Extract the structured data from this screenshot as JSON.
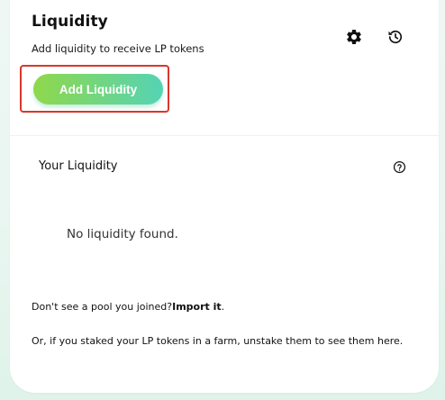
{
  "header": {
    "title": "Liquidity",
    "subtitle": "Add liquidity to receive LP tokens",
    "settings_icon": "gear-icon",
    "history_icon": "history-icon",
    "add_button_label": "Add Liquidity"
  },
  "main": {
    "section_title": "Your Liquidity",
    "help_icon": "question-circle-icon",
    "empty_state": "No liquidity found.",
    "pool_prompt": "Don't see a pool you joined?",
    "pool_link": "Import it",
    "pool_period": ".",
    "stake_note": "Or, if you staked your LP tokens in a farm, unstake them to see them here."
  },
  "colors": {
    "button_gradient_start": "#8fd84a",
    "button_gradient_end": "#55d3b5",
    "highlight_border": "#d9362b"
  }
}
